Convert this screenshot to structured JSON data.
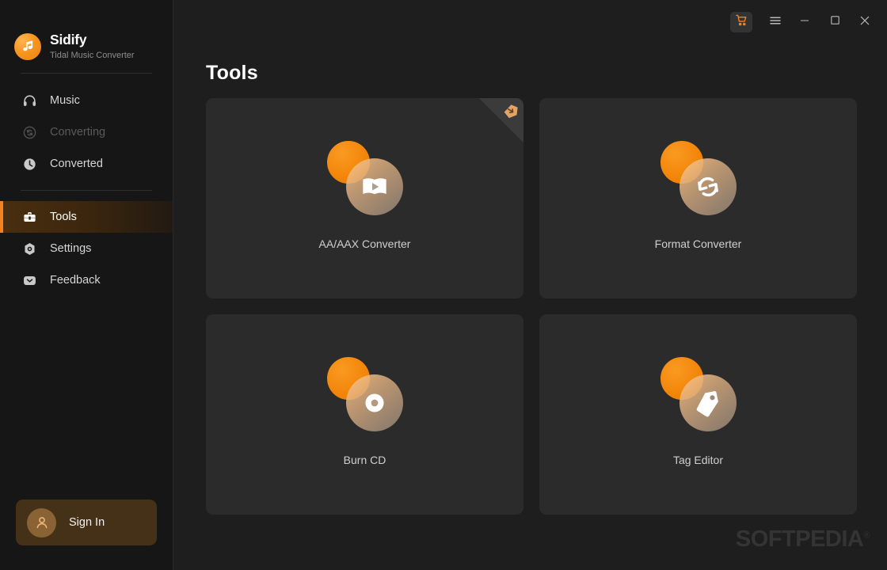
{
  "app": {
    "brand_name": "Sidify",
    "brand_subtitle": "Tidal Music Converter",
    "logo_icon": "music-note-icon"
  },
  "titlebar": {
    "buttons": [
      {
        "name": "cart-button",
        "icon": "shopping-cart-icon",
        "label": "Cart"
      },
      {
        "name": "menu-button",
        "icon": "hamburger-menu-icon",
        "label": "Menu"
      },
      {
        "name": "minimize-button",
        "icon": "minimize-icon",
        "label": "Minimize"
      },
      {
        "name": "maximize-button",
        "icon": "maximize-icon",
        "label": "Maximize"
      },
      {
        "name": "close-button",
        "icon": "close-icon",
        "label": "Close"
      }
    ]
  },
  "sidebar": {
    "items": [
      {
        "label": "Music",
        "icon": "headphones-icon",
        "state": "normal"
      },
      {
        "label": "Converting",
        "icon": "refresh-circle-icon",
        "state": "disabled"
      },
      {
        "label": "Converted",
        "icon": "clock-icon",
        "state": "normal"
      },
      {
        "label": "Tools",
        "icon": "toolbox-icon",
        "state": "active"
      },
      {
        "label": "Settings",
        "icon": "gear-icon",
        "state": "normal"
      },
      {
        "label": "Feedback",
        "icon": "message-icon",
        "state": "normal"
      }
    ],
    "signin": {
      "label": "Sign In",
      "icon": "user-avatar-icon"
    }
  },
  "main": {
    "page_title": "Tools",
    "cards": [
      {
        "label": "AA/AAX Converter",
        "icon": "play-book-icon",
        "has_corner_ribbon": true,
        "ribbon_icon": "download-badge-icon"
      },
      {
        "label": "Format Converter",
        "icon": "refresh-sync-icon",
        "has_corner_ribbon": false,
        "ribbon_icon": ""
      },
      {
        "label": "Burn CD",
        "icon": "compact-disc-icon",
        "has_corner_ribbon": false,
        "ribbon_icon": ""
      },
      {
        "label": "Tag Editor",
        "icon": "price-tag-icon",
        "has_corner_ribbon": false,
        "ribbon_icon": ""
      }
    ],
    "watermark": "SOFTPEDIA",
    "watermark_mark": "®"
  },
  "colors": {
    "accent": "#f58220",
    "sidebar_bg": "#161616",
    "main_bg": "#1e1e1e",
    "card_bg": "#2b2b2b",
    "active_nav_bg": "#4a2f10",
    "signin_bg": "#453018"
  }
}
